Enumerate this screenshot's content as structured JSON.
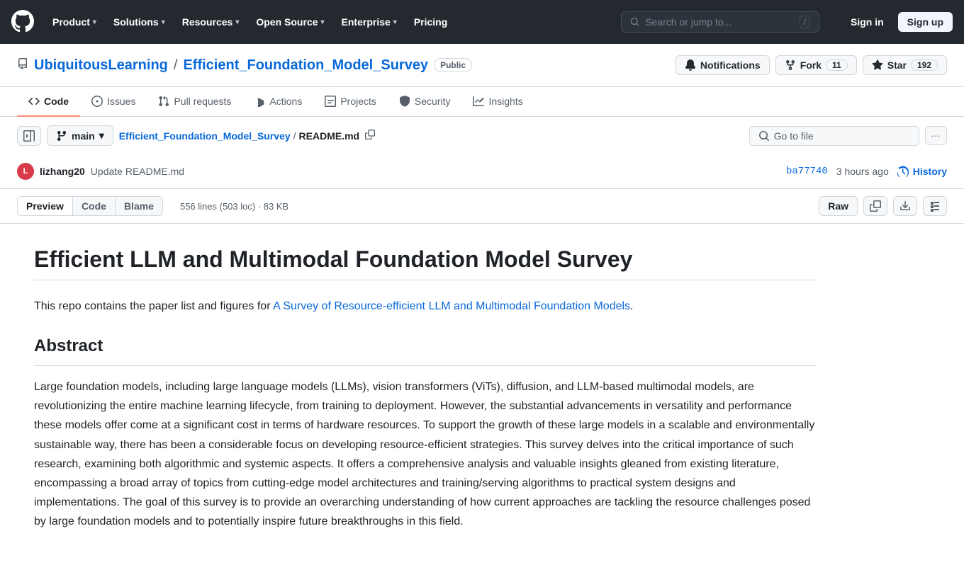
{
  "topnav": {
    "logo_label": "GitHub",
    "items": [
      {
        "label": "Product",
        "has_dropdown": true
      },
      {
        "label": "Solutions",
        "has_dropdown": true
      },
      {
        "label": "Resources",
        "has_dropdown": true
      },
      {
        "label": "Open Source",
        "has_dropdown": true
      },
      {
        "label": "Enterprise",
        "has_dropdown": true
      },
      {
        "label": "Pricing",
        "has_dropdown": false
      }
    ],
    "search_placeholder": "Search or jump to...",
    "search_shortcut": "/",
    "signin_label": "Sign in",
    "signup_label": "Sign up"
  },
  "repo": {
    "owner": "UbiquitousLearning",
    "name": "Efficient_Foundation_Model_Survey",
    "visibility": "Public",
    "notifications_label": "Notifications",
    "fork_label": "Fork",
    "fork_count": "11",
    "star_label": "Star",
    "star_count": "192"
  },
  "tabs": [
    {
      "label": "Code",
      "icon": "code",
      "active": true
    },
    {
      "label": "Issues",
      "icon": "issue"
    },
    {
      "label": "Pull requests",
      "icon": "pr"
    },
    {
      "label": "Actions",
      "icon": "actions"
    },
    {
      "label": "Projects",
      "icon": "projects"
    },
    {
      "label": "Security",
      "icon": "security"
    },
    {
      "label": "Insights",
      "icon": "insights"
    }
  ],
  "file_header": {
    "branch": "main",
    "breadcrumb_repo": "Efficient_Foundation_Model_Survey",
    "breadcrumb_file": "README.md",
    "goto_file_placeholder": "Go to file",
    "more_label": "···"
  },
  "commit": {
    "author_avatar": "L",
    "author": "lizhang20",
    "message": "Update README.md",
    "hash": "ba77740",
    "time": "3 hours ago",
    "history_label": "History"
  },
  "file_view": {
    "tabs": [
      "Preview",
      "Code",
      "Blame"
    ],
    "active_tab": "Preview",
    "stats": "556 lines (503 loc) · 83 KB",
    "raw_label": "Raw"
  },
  "readme": {
    "title": "Efficient LLM and Multimodal Foundation Model Survey",
    "intro": "This repo contains the paper list and figures for",
    "link_text": "A Survey of Resource-efficient LLM and Multimodal Foundation Models",
    "intro_end": ".",
    "abstract_title": "Abstract",
    "abstract_text": "Large foundation models, including large language models (LLMs), vision transformers (ViTs), diffusion, and LLM-based multimodal models, are revolutionizing the entire machine learning lifecycle, from training to deployment. However, the substantial advancements in versatility and performance these models offer come at a significant cost in terms of hardware resources. To support the growth of these large models in a scalable and environmentally sustainable way, there has been a considerable focus on developing resource-efficient strategies. This survey delves into the critical importance of such research, examining both algorithmic and systemic aspects. It offers a comprehensive analysis and valuable insights gleaned from existing literature, encompassing a broad array of topics from cutting-edge model architectures and training/serving algorithms to practical system designs and implementations. The goal of this survey is to provide an overarching understanding of how current approaches are tackling the resource challenges posed by large foundation models and to potentially inspire future breakthroughs in this field."
  }
}
